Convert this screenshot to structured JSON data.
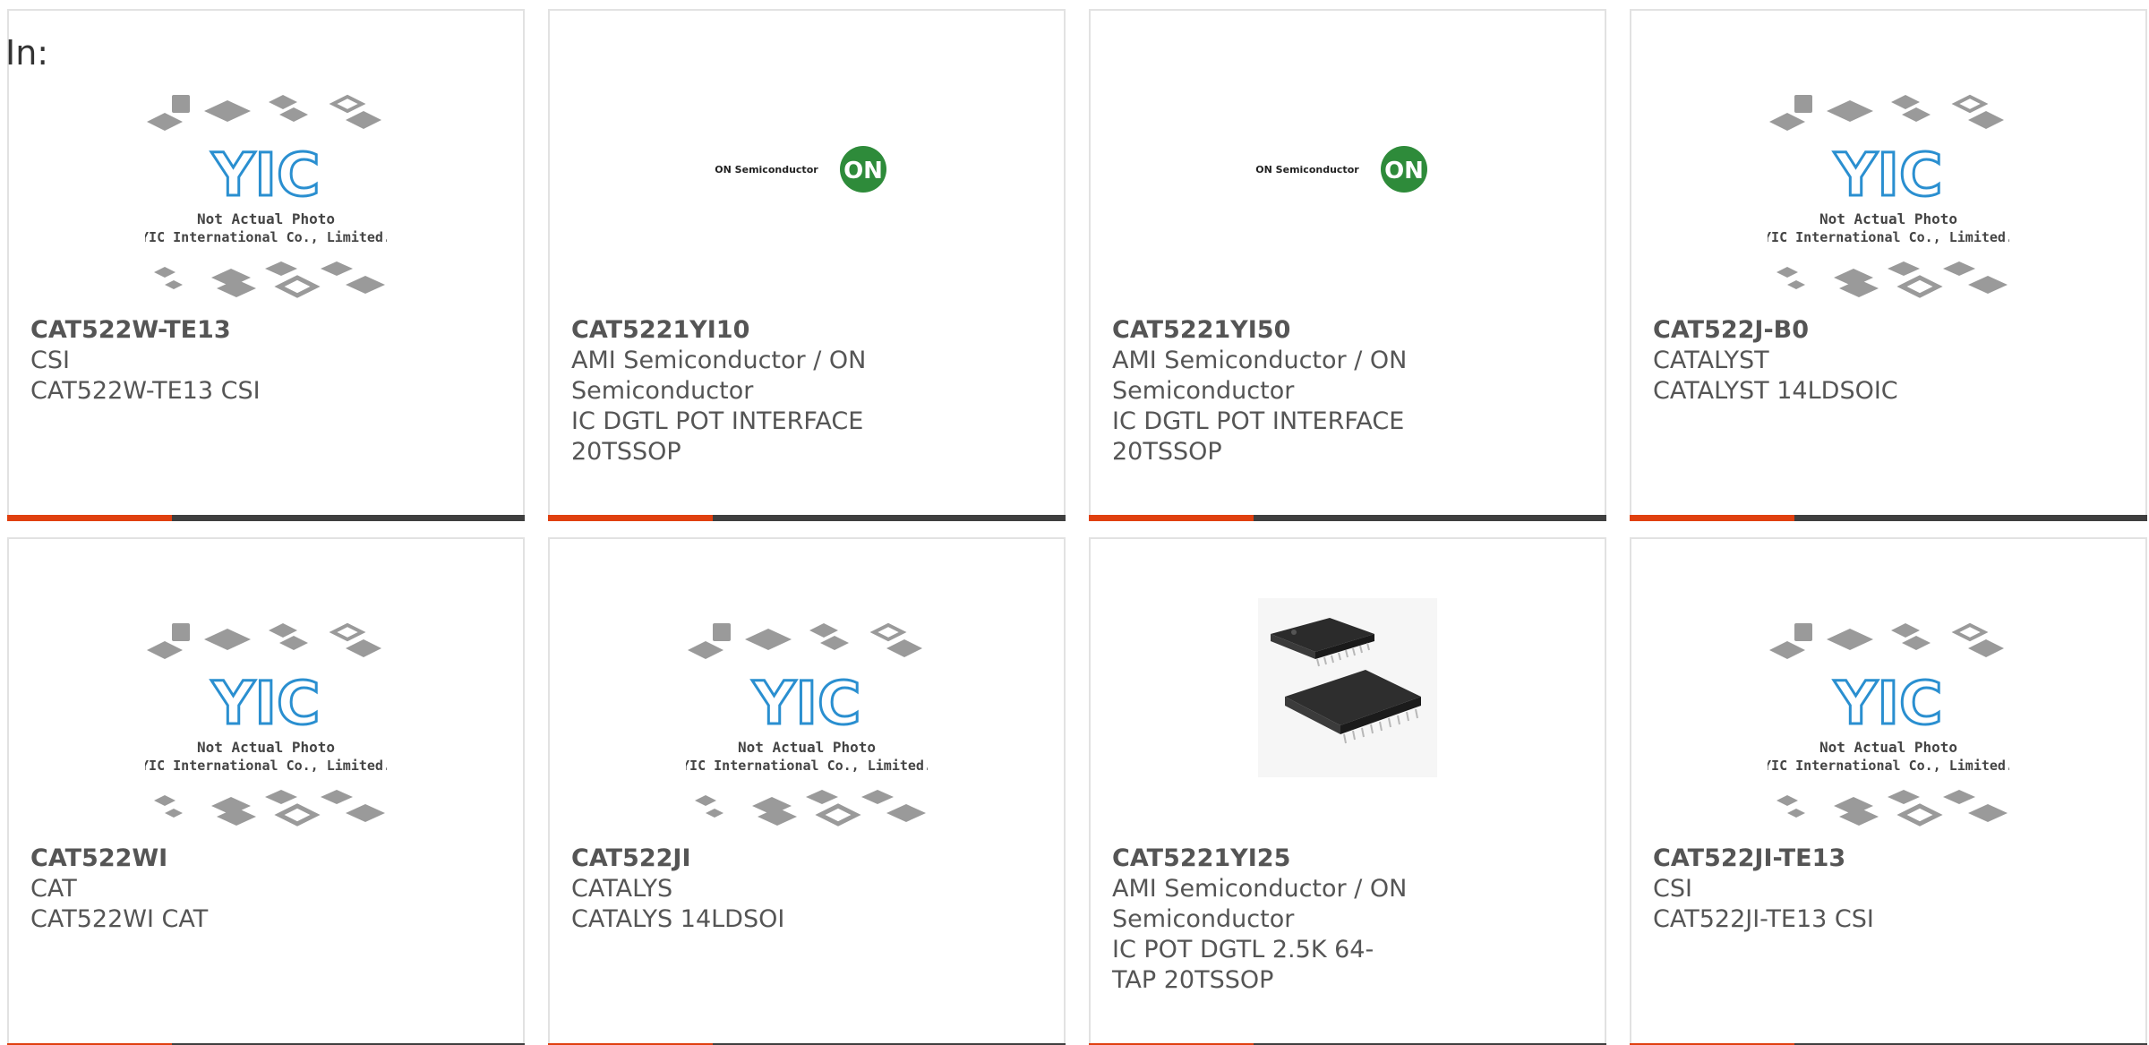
{
  "page": {
    "in_label": "In:"
  },
  "placeholder_image": {
    "line1": "Not Actual Photo",
    "line2": "YIC International Co., Limited."
  },
  "on_logo": {
    "brand_text": "ON Semiconductor",
    "mark": "ON"
  },
  "colors": {
    "accent": "#e0400f",
    "bar": "#3f3f3f",
    "text": "#555555",
    "yic_blue": "#2a8fd0",
    "on_green": "#2e8b3a"
  },
  "products": [
    {
      "part_number": "CAT522W-TE13",
      "manufacturer": "CSI",
      "description": "CAT522W-TE13 CSI",
      "image": "yic-placeholder"
    },
    {
      "part_number": "CAT5221YI10",
      "manufacturer": "AMI Semiconductor / ON Semiconductor",
      "description": "IC DGTL POT INTERFACE 20TSSOP",
      "image": "on-semiconductor-logo"
    },
    {
      "part_number": "CAT5221YI50",
      "manufacturer": "AMI Semiconductor / ON Semiconductor",
      "description": "IC DGTL POT INTERFACE 20TSSOP",
      "image": "on-semiconductor-logo"
    },
    {
      "part_number": "CAT522J-B0",
      "manufacturer": "CATALYST",
      "description": "CATALYST 14LDSOIC",
      "image": "yic-placeholder"
    },
    {
      "part_number": "CAT522WI",
      "manufacturer": "CAT",
      "description": "CAT522WI CAT",
      "image": "yic-placeholder"
    },
    {
      "part_number": "CAT522JI",
      "manufacturer": "CATALYS",
      "description": "CATALYS 14LDSOI",
      "image": "yic-placeholder"
    },
    {
      "part_number": "CAT5221YI25",
      "manufacturer": "AMI Semiconductor / ON Semiconductor",
      "description": "IC POT DGTL 2.5K 64-TAP 20TSSOP",
      "image": "tssop-chip-photo"
    },
    {
      "part_number": "CAT522JI-TE13",
      "manufacturer": "CSI",
      "description": "CAT522JI-TE13 CSI",
      "image": "yic-placeholder"
    }
  ]
}
